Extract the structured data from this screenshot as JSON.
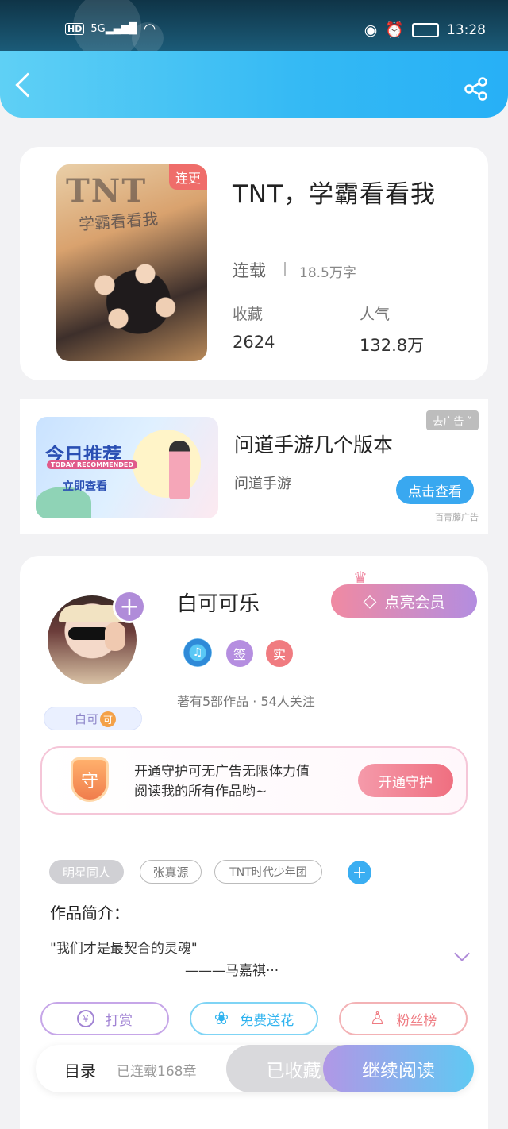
{
  "status_bar": {
    "hd": "HD",
    "net": "5G",
    "time": "13:28"
  },
  "book": {
    "title": "TNT，学霸看看我",
    "cover_title": "TNT",
    "cover_subtitle": "学霸看看我",
    "cover_tag": "连更",
    "status": "连载",
    "words": "18.5万字",
    "collect_label": "收藏",
    "collect_value": "2624",
    "popularity_label": "人气",
    "popularity_value": "132.8万"
  },
  "ad": {
    "image_title": "今日推荐",
    "image_subtitle": "TODAY RECOMMENDED",
    "image_cta": "立即查看",
    "title": "问道手游几个版本",
    "subtitle": "问道手游",
    "close_label": "去广告 ˅",
    "button": "点击查看",
    "source": "百青藤广告"
  },
  "author": {
    "name": "白可可乐",
    "nameplate": "白可",
    "nameplate_badge": "可",
    "vip_button": "点亮会员",
    "badge_sign": "签",
    "badge_real": "实",
    "stats": "著有5部作品 · 54人关注",
    "guard_text_line1": "开通守护可无广告无限体力值",
    "guard_text_line2": "阅读我的所有作品哟~",
    "guard_shield": "守",
    "guard_button": "开通守护"
  },
  "tags": [
    "明星同人",
    "张真源",
    "TNT时代少年团"
  ],
  "intro": {
    "title": "作品简介：",
    "line1": "\"我们才是最契合的灵魂\"",
    "line2": "———马嘉祺···"
  },
  "actions": {
    "reward": "打赏",
    "flower": "免费送花",
    "fans": "粉丝榜"
  },
  "bottom": {
    "toc": "目录",
    "chapters": "已连载168章",
    "collected": "已收藏",
    "continue": "继续阅读"
  },
  "colors": {
    "header_blue": "#34b9f4",
    "accent_purple": "#b08cd9",
    "accent_pink": "#ef6f80",
    "accent_blue": "#39a8f0"
  }
}
